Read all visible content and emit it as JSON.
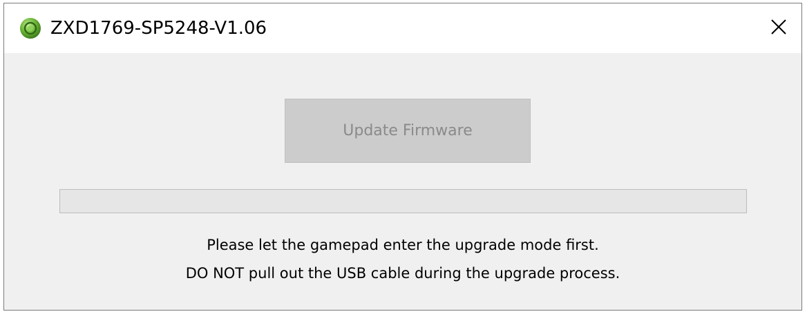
{
  "window": {
    "title": "ZXD1769-SP5248-V1.06",
    "app_icon": "green-orb-icon",
    "close_icon": "close-icon"
  },
  "main": {
    "update_button_label": "Update Firmware",
    "update_button_enabled": false,
    "progress": 0,
    "message_line1": "Please let the gamepad enter the upgrade mode first.",
    "message_line2": "DO NOT pull out the USB cable during the upgrade process."
  },
  "colors": {
    "icon_green": "#6fb83a",
    "button_disabled_bg": "#cccccc",
    "button_disabled_text": "#8a8a8a"
  }
}
